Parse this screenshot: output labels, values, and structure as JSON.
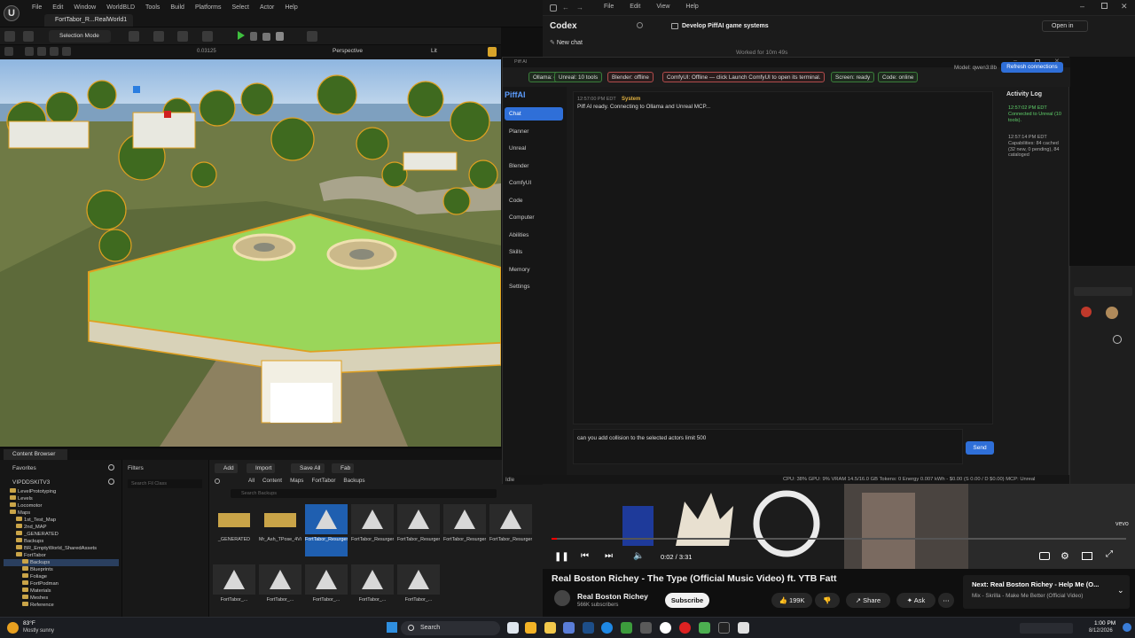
{
  "unreal": {
    "menu": [
      "File",
      "Edit",
      "Window",
      "WorldBLD",
      "Tools",
      "Build",
      "Platforms",
      "Select",
      "Actor",
      "Help"
    ],
    "level_tab": "FortTabor_R...RealWorld1",
    "selection_mode": "Selection Mode",
    "viewport_mode": "Perspective",
    "lit_mode": "Lit",
    "coord_readout": "0.03125",
    "content_browser": {
      "tab": "Content Browser",
      "favorites": "Favorites",
      "project": "VIPDDSKITV3",
      "filters": "Filters",
      "filter_search": "Search Fil Class",
      "add": "Add",
      "import": "Import",
      "save_all": "Save All",
      "fab": "Fab",
      "breadcrumb": [
        "All",
        "Content",
        "Maps",
        "FortTabor",
        "Backups"
      ],
      "search_placeholder": "Search Backups",
      "tree": [
        {
          "label": "LevelPrototyping",
          "indent": 1
        },
        {
          "label": "Levels",
          "indent": 1
        },
        {
          "label": "Locomotor",
          "indent": 1
        },
        {
          "label": "Maps",
          "indent": 1
        },
        {
          "label": "1st_Test_Map",
          "indent": 2
        },
        {
          "label": "2nd_MAP",
          "indent": 2
        },
        {
          "label": "_GENERATED",
          "indent": 2
        },
        {
          "label": "Backups",
          "indent": 2
        },
        {
          "label": "BR_EmptyWorld_SharedAssets",
          "indent": 2
        },
        {
          "label": "FortTabor",
          "indent": 2
        },
        {
          "label": "Backups",
          "indent": 3
        },
        {
          "label": "Blueprints",
          "indent": 3
        },
        {
          "label": "Foliage",
          "indent": 3
        },
        {
          "label": "FortPodman",
          "indent": 3
        },
        {
          "label": "Materials",
          "indent": 3
        },
        {
          "label": "Meshes",
          "indent": 3
        },
        {
          "label": "Reference",
          "indent": 3
        }
      ],
      "assets_row1": [
        {
          "name": "_GENERATED",
          "type": "folder"
        },
        {
          "name": "Mr_Ash_TPose_4View_2K_Skin_Tokens_AutoRig_Mixamo",
          "type": "folder"
        },
        {
          "name": "FortTabor_Resurgence_RealWorld1",
          "type": "level",
          "selected": true
        },
        {
          "name": "FortTabor_Resurgence_RealWorld1_P...",
          "type": "level"
        },
        {
          "name": "FortTabor_Resurgence_RealWorld_...",
          "type": "level"
        },
        {
          "name": "FortTabor_Resurgence_RealWorld_DSM...",
          "type": "level"
        },
        {
          "name": "FortTabor_Resurgence_RealWorld_Pre...",
          "type": "level"
        }
      ],
      "assets_row2": [
        "FortTabor_...",
        "FortTabor_...",
        "FortTabor_...",
        "FortTabor_...",
        "FortTabor_..."
      ]
    }
  },
  "codex": {
    "menu": [
      "File",
      "Edit",
      "View",
      "Help"
    ],
    "title": "Codex",
    "new_chat": "New chat",
    "thread_title": "Develop PiffAI game systems",
    "worked_for": "Worked for 10m 49s",
    "open_in": "Open in"
  },
  "piffai": {
    "window_title": "Piff AI",
    "brand": "PiffAI",
    "status_pills": [
      {
        "label": "Ollama: online",
        "ok": true
      },
      {
        "label": "Unreal: 10 tools",
        "ok": true
      },
      {
        "label": "Blender: offline",
        "ok": false
      },
      {
        "label": "ComfyUI: Offline — click Launch ComfyUI to open its terminal.",
        "ok": false
      },
      {
        "label": "Screen: ready",
        "ok": true
      },
      {
        "label": "Code: online",
        "ok": true
      }
    ],
    "model": "Model: qwen3:8b",
    "refresh": "Refresh connections",
    "nav": [
      "Chat",
      "Planner",
      "Unreal",
      "Blender",
      "ComfyUI",
      "Code",
      "Computer",
      "Abilities",
      "Skills",
      "Memory",
      "Settings"
    ],
    "message": {
      "time": "12:57:00 PM EDT",
      "sender": "System",
      "text": "Piff AI ready. Connecting to Ollama and Unreal MCP..."
    },
    "input_text": "can you add collision to the selected actors limit 500",
    "send": "Send",
    "activity_title": "Activity Log",
    "activity": [
      {
        "time": "12:57:02 PM EDT",
        "text": "Connected to Unreal (10 tools).",
        "color": "#5fd06a"
      },
      {
        "time": "12:57:14 PM EDT",
        "text": "Capabilities: 84 cached (32 new, 0 pending), 84 cataloged",
        "color": "#aaaaaa"
      }
    ],
    "footer_status": "Idle",
    "footer_stats": "CPU: 38%  GPU: 9%  VRAM 14.5/16.0 GB  Tokens: 0  Energy 0.007 kWh - $0.00 (S 0.00 / D $0.00)  MCP: Unreal"
  },
  "youtube": {
    "time": "0:02 / 3:31",
    "title": "Real Boston Richey - The Type (Official Music Video) ft. YTB Fatt",
    "channel": "Real Boston Richey",
    "subscribers": "566K subscribers",
    "subscribe": "Subscribe",
    "likes": "199K",
    "share": "Share",
    "ask": "Ask",
    "next_title": "Next: Real Boston Richey - Help Me (O...",
    "next_sub": "Mix - Skrilla - Make Me Better (Official Video)",
    "watermark": "vevo",
    "progress": 0.01
  },
  "taskbar": {
    "weather_temp": "83°F",
    "weather_desc": "Mostly sunny",
    "search": "Search",
    "time": "1:00 PM",
    "date": "8/12/2026"
  }
}
